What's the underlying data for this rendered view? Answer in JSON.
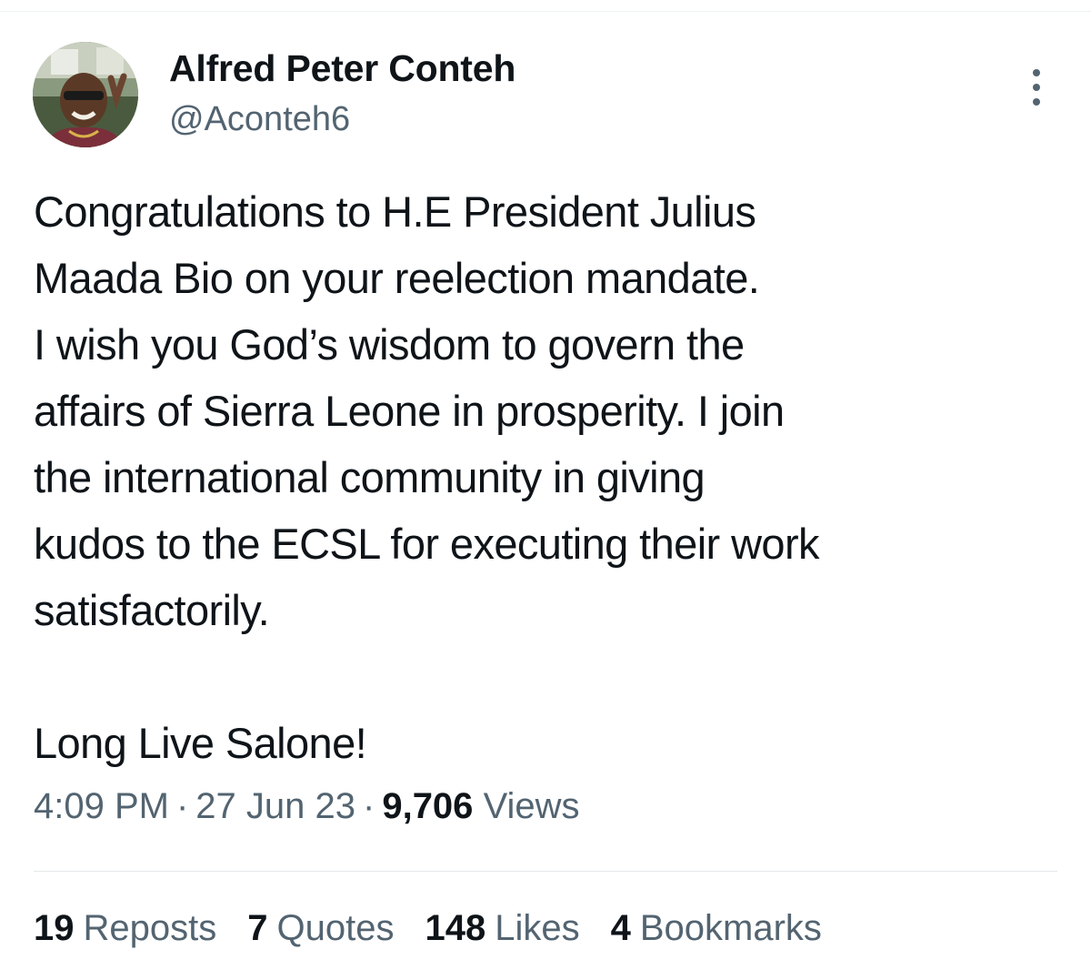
{
  "author": {
    "display_name": "Alfred Peter Conteh",
    "handle": "@Aconteh6"
  },
  "tweet": {
    "lines": [
      "Congratulations to H.E President Julius",
      "Maada Bio on your reelection mandate.",
      "I wish you God’s wisdom to govern the",
      "affairs of Sierra Leone in prosperity. I join",
      "the international community in giving",
      "kudos to the ECSL for executing their work",
      "satisfactorily.",
      "Long Live Salone!"
    ]
  },
  "meta": {
    "time": "4:09 PM",
    "separator": "·",
    "date": "27 Jun 23",
    "views_count": "9,706",
    "views_label": "Views"
  },
  "stats": {
    "reposts_count": "19",
    "reposts_label": "Reposts",
    "quotes_count": "7",
    "quotes_label": "Quotes",
    "likes_count": "148",
    "likes_label": "Likes",
    "bookmarks_count": "4",
    "bookmarks_label": "Bookmarks"
  },
  "icons": {
    "more": "more-vertical-icon"
  }
}
